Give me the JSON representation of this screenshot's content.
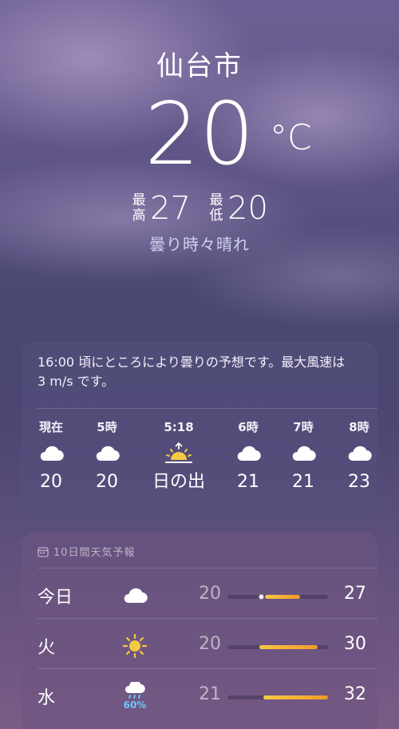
{
  "location": {
    "city": "仙台市"
  },
  "current": {
    "temperature": "20",
    "unit": "°C",
    "high_label_1": "最",
    "high_label_2": "高",
    "high": "27",
    "low_label_1": "最",
    "low_label_2": "低",
    "low": "20",
    "condition": "曇り時々晴れ"
  },
  "hourly": {
    "summary": "16:00 頃にところにより曇りの予想です。最大風速は 3 m/s です。",
    "items": [
      {
        "time": "現在",
        "icon": "cloud-icon",
        "value": "20"
      },
      {
        "time": "5時",
        "icon": "cloud-icon",
        "value": "20"
      },
      {
        "time": "5:18",
        "icon": "sunrise-icon",
        "value": "日の出"
      },
      {
        "time": "6時",
        "icon": "cloud-icon",
        "value": "21"
      },
      {
        "time": "7時",
        "icon": "cloud-icon",
        "value": "21"
      },
      {
        "time": "8時",
        "icon": "cloud-icon",
        "value": "23"
      }
    ]
  },
  "forecast": {
    "title": "10日間天気予報",
    "icon": "calendar-icon",
    "days": [
      {
        "day": "今日",
        "icon": "cloud-icon",
        "precip": "",
        "low": "20",
        "high": "27",
        "bar_start": 0.37,
        "bar_end": 0.72,
        "current_marker": 0.33
      },
      {
        "day": "火",
        "icon": "sun-icon",
        "precip": "",
        "low": "20",
        "high": "30",
        "bar_start": 0.32,
        "bar_end": 0.9
      },
      {
        "day": "水",
        "icon": "rain-cloud-icon",
        "precip": "60%",
        "low": "21",
        "high": "32",
        "bar_start": 0.36,
        "bar_end": 1.0
      }
    ]
  },
  "colors": {
    "bar_start": "#f6c945",
    "bar_end": "#f39a2a",
    "precip": "#6ec6ff",
    "condition": "#cfd3ee"
  }
}
